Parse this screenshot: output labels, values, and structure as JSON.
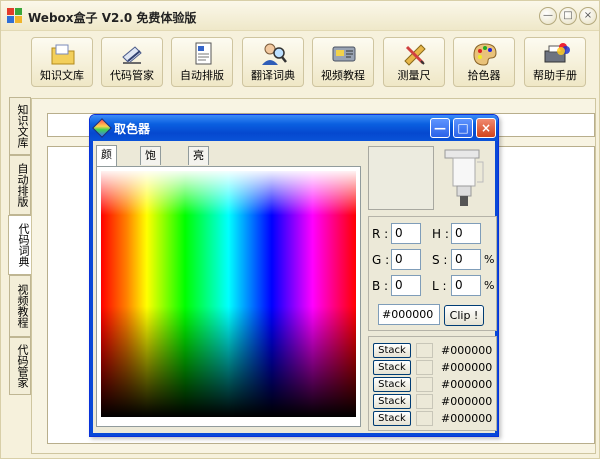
{
  "app": {
    "title": "Webox盒子 V2.0  免费体验版",
    "window_controls": [
      "minimize",
      "maximize",
      "close"
    ]
  },
  "toolbar": {
    "items": [
      {
        "label": "知识文库",
        "icon": "folder-icon"
      },
      {
        "label": "代码管家",
        "icon": "code-pen-icon"
      },
      {
        "label": "自动排版",
        "icon": "document-icon"
      },
      {
        "label": "翻译词典",
        "icon": "person-magnifier-icon"
      },
      {
        "label": "视频教程",
        "icon": "video-card-icon"
      },
      {
        "label": "测量尺",
        "icon": "ruler-pencil-icon"
      },
      {
        "label": "拾色器",
        "icon": "palette-icon"
      },
      {
        "label": "帮助手册",
        "icon": "help-printer-icon"
      }
    ]
  },
  "sidetabs": {
    "items": [
      "知识文库",
      "自动排版",
      "代码词典",
      "视频教程",
      "代码管家"
    ],
    "active_index": 2
  },
  "picker": {
    "title": "取色器",
    "tabs": [
      "颜色",
      "饱和度",
      "亮度"
    ],
    "active_tab": 0,
    "fields": {
      "r_label": "R :",
      "r_value": "0",
      "g_label": "G :",
      "g_value": "0",
      "b_label": "B :",
      "b_value": "0",
      "h_label": "H :",
      "h_value": "0",
      "s_label": "S :",
      "s_value": "0",
      "l_label": "L :",
      "l_value": "0",
      "pct": "%"
    },
    "hex_value": "#000000",
    "clip_label": "Clip !",
    "stack_label": "Stack",
    "stack": [
      {
        "hex": "#000000"
      },
      {
        "hex": "#000000"
      },
      {
        "hex": "#000000"
      },
      {
        "hex": "#000000"
      },
      {
        "hex": "#000000"
      }
    ]
  },
  "colors": {
    "titlebar_blue": "#0548cf",
    "window_bg": "#ece9d8",
    "app_bg": "#f6f1dc"
  }
}
